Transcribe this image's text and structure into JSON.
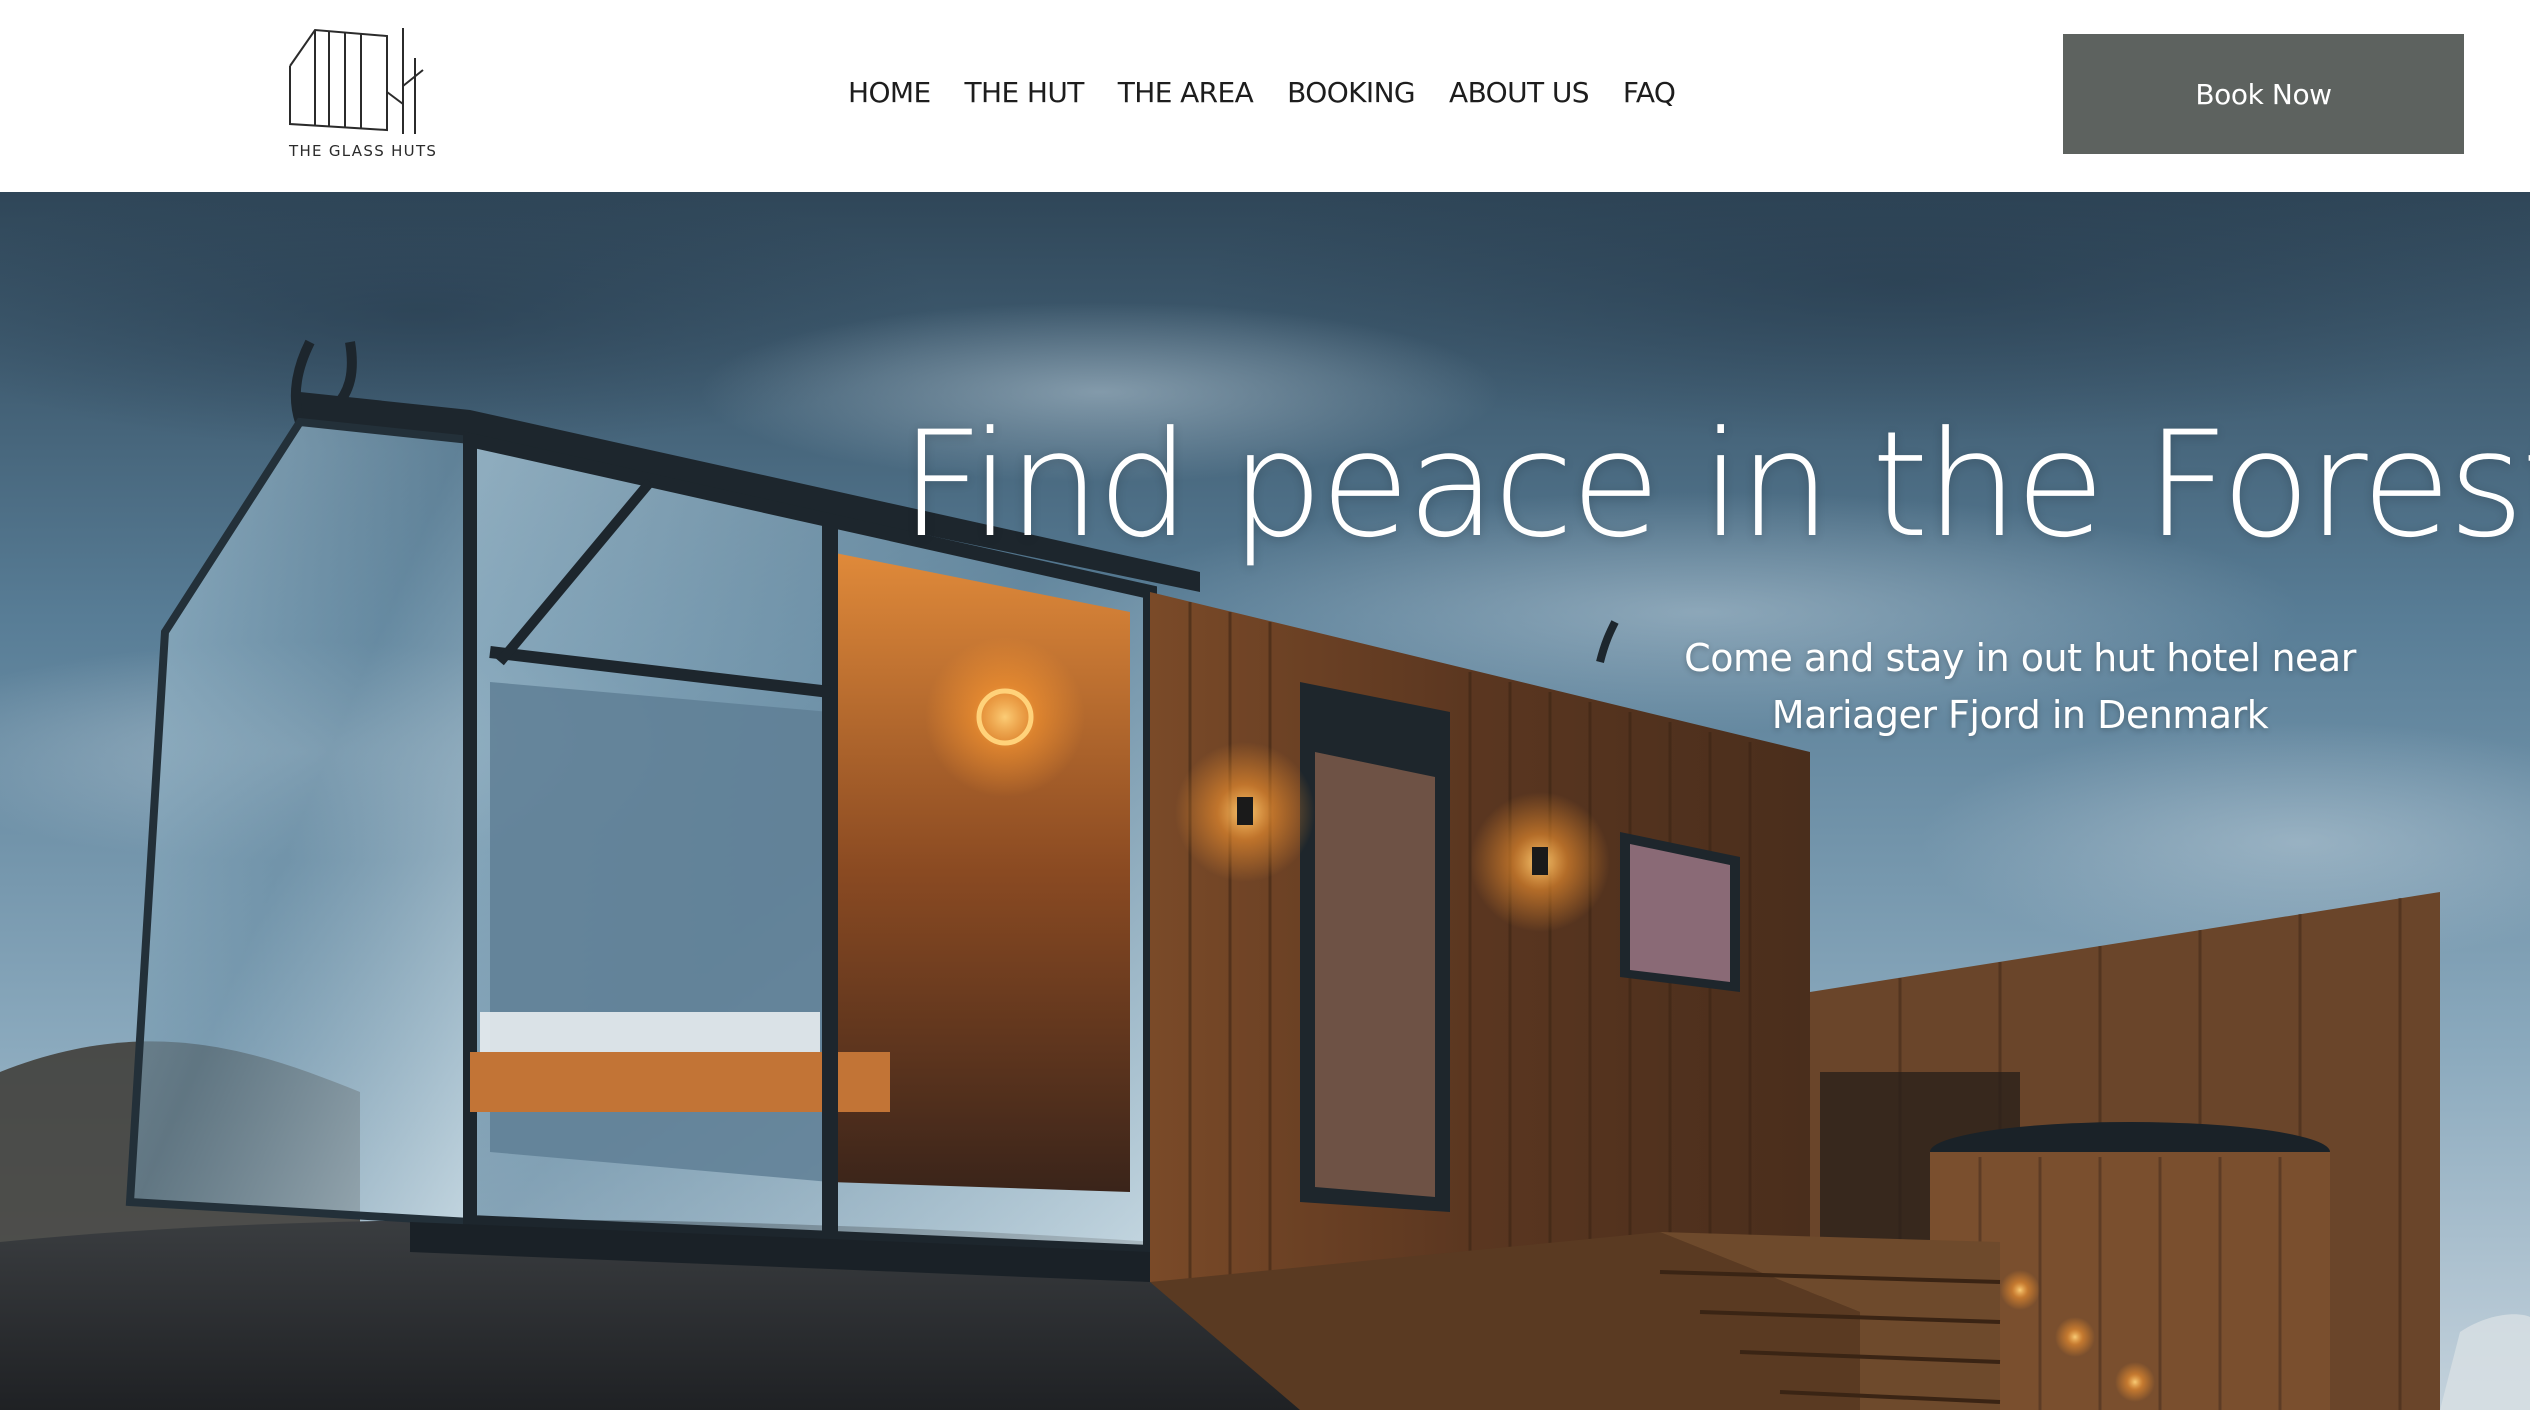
{
  "header": {
    "logo_text": "THE GLASS HUTS",
    "nav": [
      {
        "label": "HOME"
      },
      {
        "label": "THE HUT"
      },
      {
        "label": "THE AREA"
      },
      {
        "label": "BOOKING"
      },
      {
        "label": "ABOUT US"
      },
      {
        "label": "FAQ"
      }
    ],
    "cta_label": "Book Now",
    "cta_color": "#5d625f"
  },
  "hero": {
    "title": "Find peace in the Forest",
    "subtitle_line1": "Come and stay in out hut hotel near",
    "subtitle_line2": "Mariager Fjord in Denmark",
    "image_subject": "glass-hut-cabin-at-dusk"
  },
  "icons": {
    "logo": "glass-hut-logo-icon"
  }
}
